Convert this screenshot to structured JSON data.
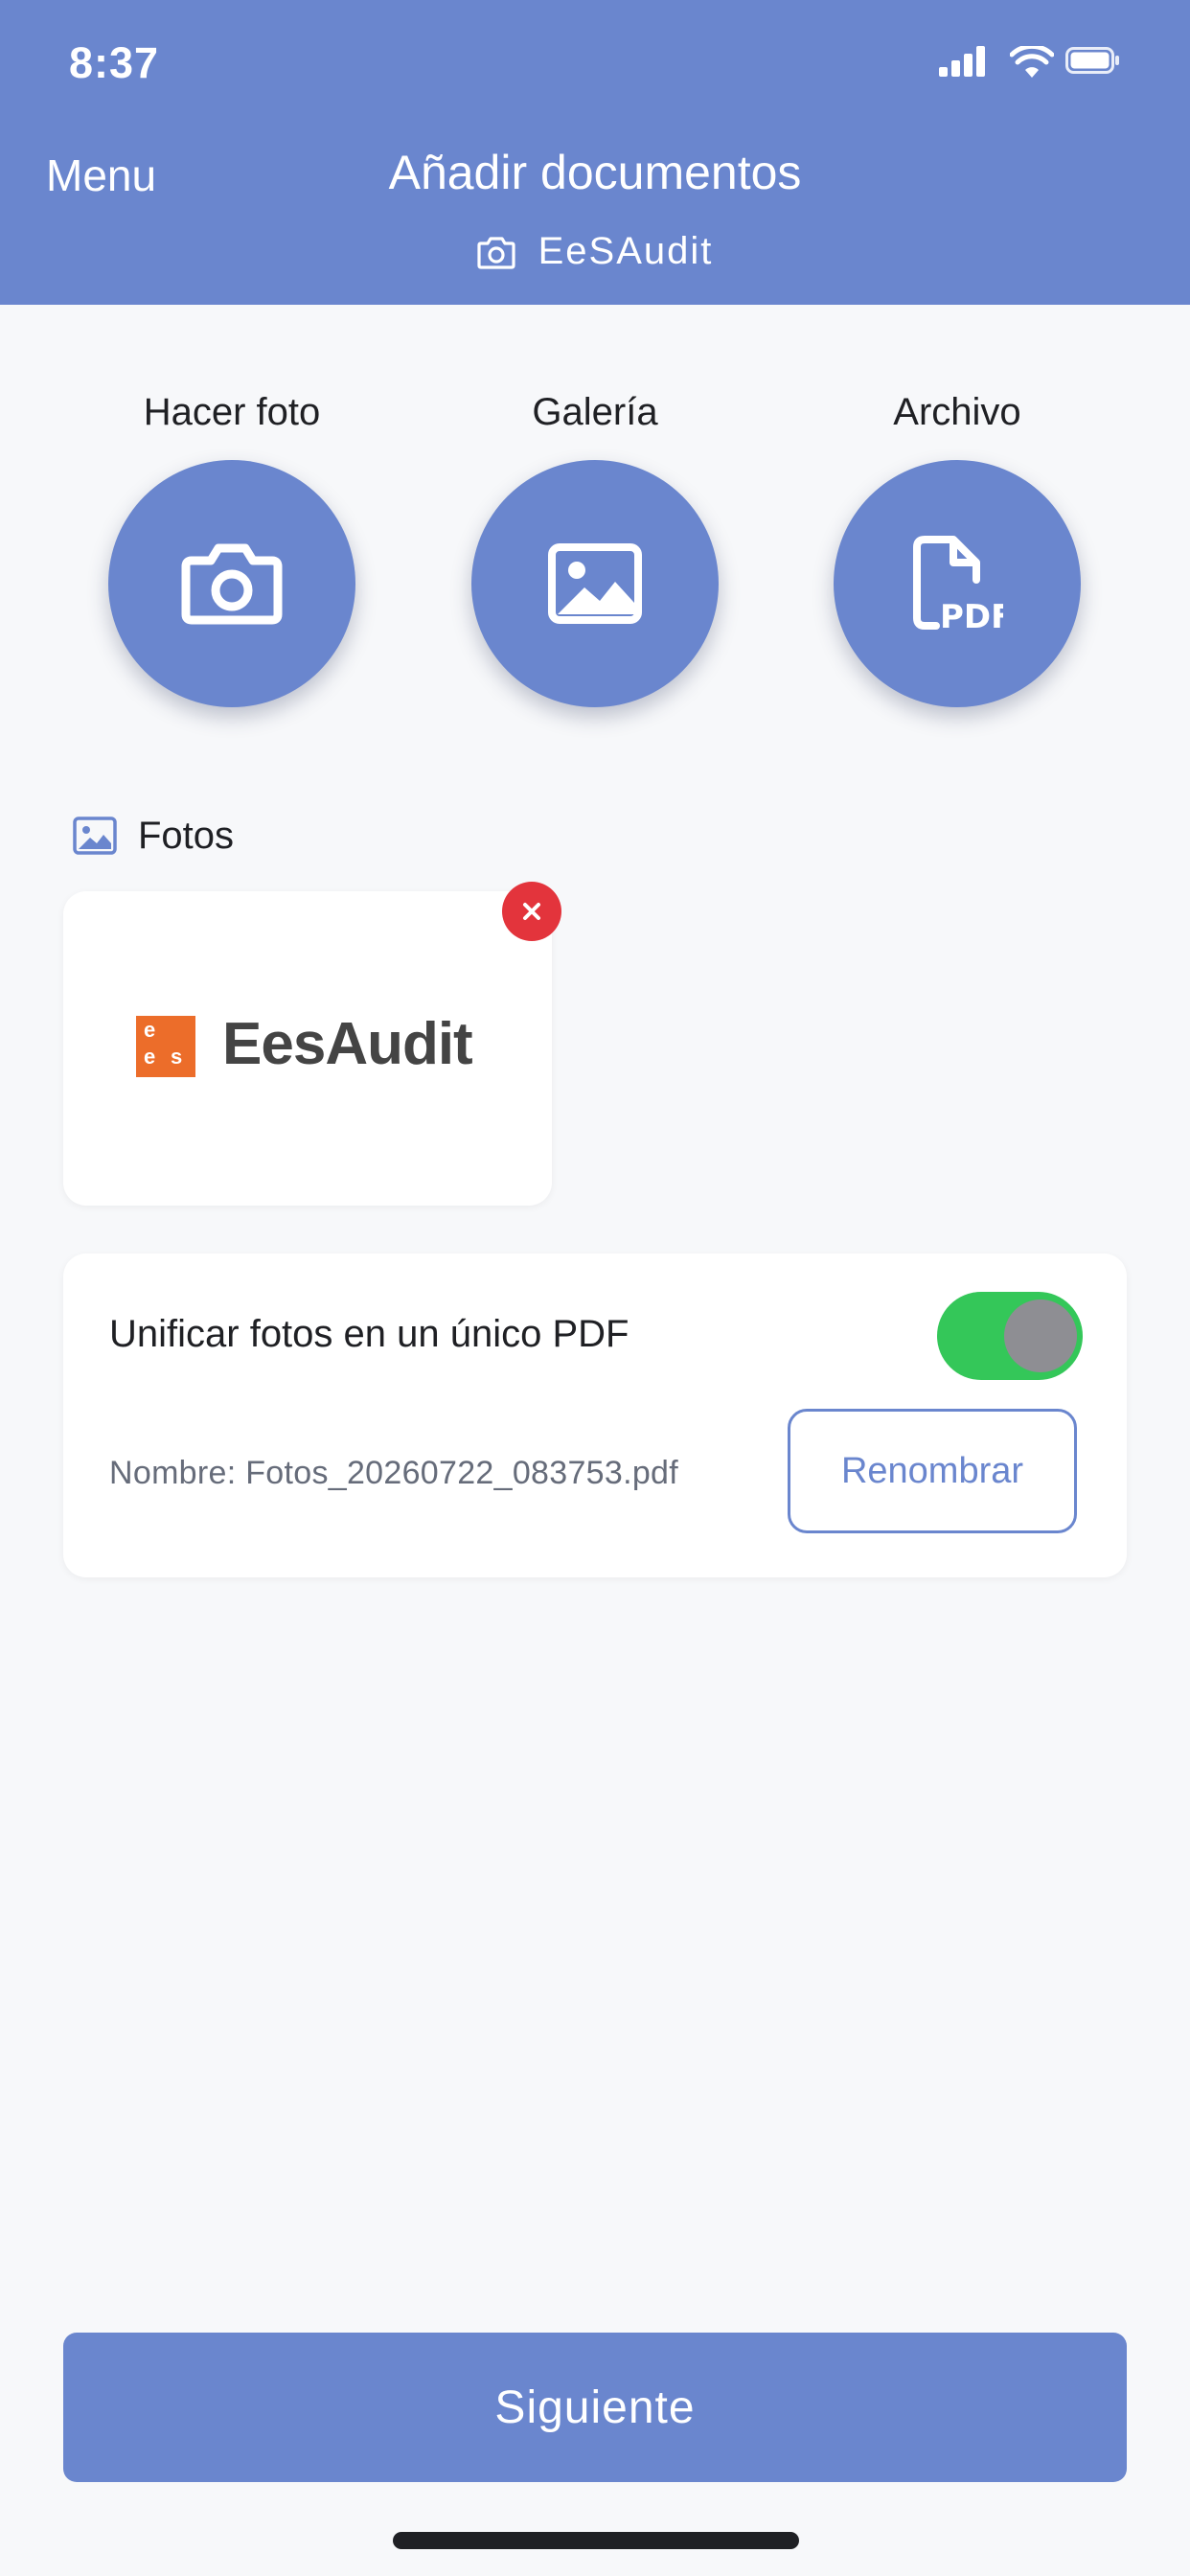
{
  "status_bar": {
    "time": "8:37",
    "icons": [
      "cellular-signal-icon",
      "wifi-icon",
      "battery-icon"
    ]
  },
  "nav": {
    "menu_label": "Menu",
    "title": "Añadir documentos",
    "subtitle": "EeSAudit",
    "subtitle_icon": "camera-icon"
  },
  "actions": [
    {
      "label": "Hacer foto",
      "icon": "camera-icon"
    },
    {
      "label": "Galería",
      "icon": "image-icon"
    },
    {
      "label": "Archivo",
      "icon": "pdf-file-icon"
    }
  ],
  "photos_section": {
    "title": "Fotos",
    "icon": "image-icon",
    "items": [
      {
        "logo_text": "EesAudit",
        "logo_mark": "e e s",
        "remove_icon": "close-icon"
      }
    ]
  },
  "pdf_options": {
    "merge_label": "Unificar fotos en un único PDF",
    "merge_enabled": true,
    "file_name": "Nombre: Fotos_20260722_083753.pdf",
    "rename_label": "Renombrar"
  },
  "footer": {
    "next_label": "Siguiente"
  },
  "colors": {
    "primary": "#6a86ce",
    "toggle_on": "#34c759",
    "danger": "#e3343c",
    "logo_orange": "#ec6d2a"
  }
}
